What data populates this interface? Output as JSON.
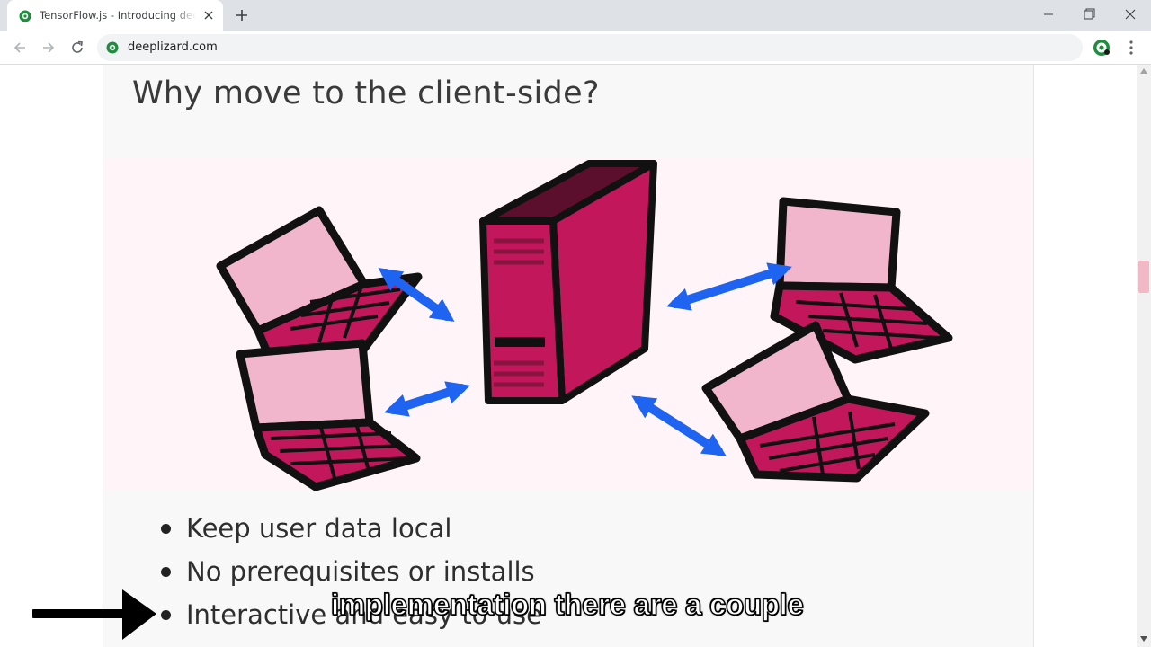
{
  "browser": {
    "tab": {
      "title": "TensorFlow.js - Introducing deep",
      "favicon": "deeplizard-favicon",
      "close_icon": "close-icon"
    },
    "new_tab_icon": "plus-icon",
    "window_controls": [
      "minimize-icon",
      "restore-icon",
      "close-icon"
    ],
    "nav_icons": [
      "back-arrow-icon",
      "forward-arrow-icon",
      "reload-icon"
    ],
    "url": "deeplizard.com",
    "extension_icon": "deeplizard-extension-icon",
    "menu_icon": "kebab-menu-icon"
  },
  "slide": {
    "title": "Why move to the client-side?",
    "illustration": "server connected to four laptops with two-way arrows",
    "bullets": [
      "Keep user data local",
      "No prerequisites or installs",
      "Interactive and easy to use"
    ]
  },
  "caption": "implementation there are a couple",
  "colors": {
    "tab_strip": "#dee1e6",
    "omnibox": "#f1f3f4",
    "server": "#c2185b",
    "server_dark": "#5c0f2c",
    "laptop_screen": "#f1b6cc",
    "laptop_keys": "#c2185b",
    "arrows": "#1e64f0",
    "scroll_thumb": "#f2b8c6"
  }
}
